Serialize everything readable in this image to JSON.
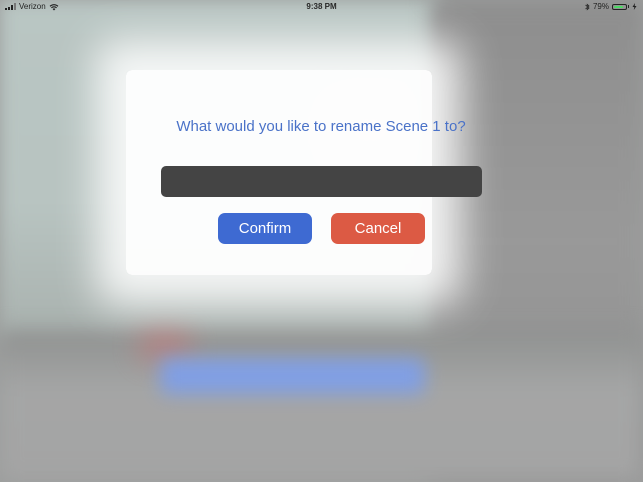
{
  "status_bar": {
    "carrier": "Verizon",
    "time": "9:38 PM",
    "battery_percent": "79%",
    "battery_level": 0.79,
    "icons": [
      "signal-icon",
      "wifi-icon",
      "bluetooth-icon",
      "battery-icon",
      "charging-icon"
    ]
  },
  "dialog": {
    "prompt": "What would you like to rename Scene 1 to?",
    "input_value": "",
    "confirm_label": "Confirm",
    "cancel_label": "Cancel"
  },
  "colors": {
    "prompt_text": "#4a72c8",
    "input_background": "#444444",
    "confirm_button": "#3e6ad2",
    "cancel_button": "#dc5a44"
  }
}
